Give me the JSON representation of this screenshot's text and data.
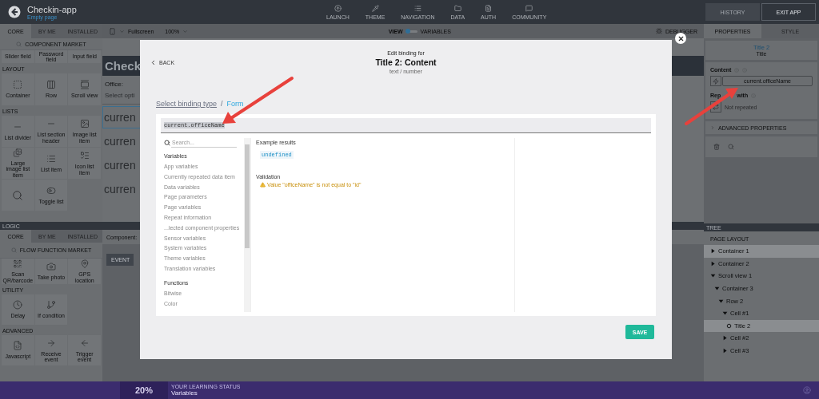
{
  "app": {
    "title": "Checkin-app",
    "page": "Empty page"
  },
  "top_nav": [
    {
      "label": "LAUNCH"
    },
    {
      "label": "THEME"
    },
    {
      "label": "NAVIGATION"
    },
    {
      "label": "DATA"
    },
    {
      "label": "AUTH"
    },
    {
      "label": "COMMUNITY"
    }
  ],
  "header_buttons": [
    {
      "label": "HISTORY",
      "disabled": true
    },
    {
      "label": "EXIT APP",
      "disabled": false
    }
  ],
  "component_tabs": [
    {
      "label": "CORE",
      "selected": true
    },
    {
      "label": "BY ME",
      "selected": false
    },
    {
      "label": "INSTALLED",
      "selected": false
    }
  ],
  "component_market": "COMPONENT MARKET",
  "component_sections": [
    {
      "tiles": [
        {
          "label": "Slider field"
        },
        {
          "label": "Password field"
        },
        {
          "label": "Input field"
        }
      ]
    },
    {
      "title": "LAYOUT",
      "tiles": [
        {
          "label": "Container"
        },
        {
          "label": "Row"
        },
        {
          "label": "Scroll view"
        }
      ]
    },
    {
      "title": "LISTS",
      "tiles": [
        {
          "label": "List divider"
        },
        {
          "label": "List section header"
        },
        {
          "label": "Image list item"
        },
        {
          "label": "Large image list item"
        },
        {
          "label": "List item"
        },
        {
          "label": "Icon list item"
        },
        {
          "kind": "bare"
        },
        {
          "label": "Toggle list"
        }
      ]
    }
  ],
  "device": "Fullscreen",
  "zoom": "100%",
  "view_toggle": [
    {
      "label": "VIEW",
      "selected": true
    },
    {
      "label": "VARIABLES",
      "selected": false
    }
  ],
  "debugger": "DEBUGGER",
  "canvas": {
    "header": "Check",
    "field_label": "Office:",
    "select": "Select opti",
    "rows": [
      {
        "text": "curren",
        "selected": true
      },
      {
        "text": "curren",
        "selected": false
      },
      {
        "text": "curren",
        "selected": false
      },
      {
        "text": "curren",
        "selected": false
      }
    ]
  },
  "logic": {
    "title": "LOGIC",
    "tabs": [
      {
        "label": "CORE",
        "selected": true
      },
      {
        "label": "BY ME",
        "selected": false
      },
      {
        "label": "INSTALLED",
        "selected": false
      }
    ],
    "market": "FLOW FUNCTION MARKET",
    "sections": [
      {
        "tiles": [
          {
            "label": "Scan QR/barcode"
          },
          {
            "label": "Take photo"
          },
          {
            "label": "GPS location"
          }
        ]
      },
      {
        "title": "UTILITY",
        "tiles": [
          {
            "label": "Delay"
          },
          {
            "label": "If condition"
          }
        ]
      },
      {
        "title": "ADVANCED",
        "tiles": [
          {
            "label": "Javascript"
          },
          {
            "label": "Receive event"
          },
          {
            "label": "Trigger event"
          }
        ]
      }
    ]
  },
  "flow": {
    "component_label": "Component:",
    "event_tab": "EVENT"
  },
  "properties": {
    "tabs": [
      {
        "label": "PROPERTIES",
        "selected": true
      },
      {
        "label": "STYLE",
        "selected": false
      }
    ],
    "component_name": "Title 2",
    "component_type": "Title",
    "content_label": "Content",
    "content_value": "current.officeName",
    "repeat_label_parts": [
      "Rep",
      "with"
    ],
    "repeat_value": "Not repeated",
    "advanced": "ADVANCED PROPERTIES"
  },
  "tree": {
    "title": "TREE",
    "section": "PAGE LAYOUT",
    "nodes": [
      {
        "label": "Container 1",
        "expanded": false,
        "selected": true
      },
      {
        "label": "Container 2",
        "expanded": false,
        "selected": false
      },
      {
        "label": "Scroll view 1",
        "expanded": true,
        "selected": false,
        "children": [
          {
            "label": "Container 3",
            "expanded": true,
            "selected": false,
            "children": [
              {
                "label": "Row 2",
                "expanded": true,
                "selected": false,
                "children": [
                  {
                    "label": "Cell #1",
                    "expanded": true,
                    "selected": false,
                    "children": [
                      {
                        "label": "Title 2",
                        "selected": true
                      }
                    ]
                  },
                  {
                    "label": "Cell #2",
                    "expanded": false,
                    "selected": false
                  },
                  {
                    "label": "Cell #3",
                    "expanded": false,
                    "selected": false
                  }
                ]
              }
            ]
          }
        ]
      }
    ]
  },
  "learning": {
    "percent": "20%",
    "label": "YOUR LEARNING STATUS",
    "topic": "Variables"
  },
  "modal": {
    "back": "BACK",
    "kicker": "Edit binding for",
    "title": "Title 2: Content",
    "subtitle": "text / number",
    "breadcrumb": [
      {
        "label": "Select binding type",
        "selected": false
      },
      {
        "label": "Form",
        "selected": true
      }
    ],
    "separator": "/",
    "formula": "current.officeName",
    "formula_selected": true,
    "search_placeholder": "Search...",
    "groups": [
      {
        "title": "Variables",
        "items": [
          "App variables",
          "Currently repeated data item",
          "Data variables",
          "Page parameters",
          "Page variables",
          "Repeat information",
          "...lected component properties",
          "Sensor variables",
          "System variables",
          "Theme variables",
          "Translation variables"
        ]
      },
      {
        "title": "Functions",
        "items": [
          "Bitwise",
          "Color"
        ]
      }
    ],
    "example_label": "Example results",
    "example_value": "undefined",
    "validation_label": "Validation",
    "validation_message": "Value \"officeName\" is not equal to \"id\"",
    "save": "SAVE"
  }
}
